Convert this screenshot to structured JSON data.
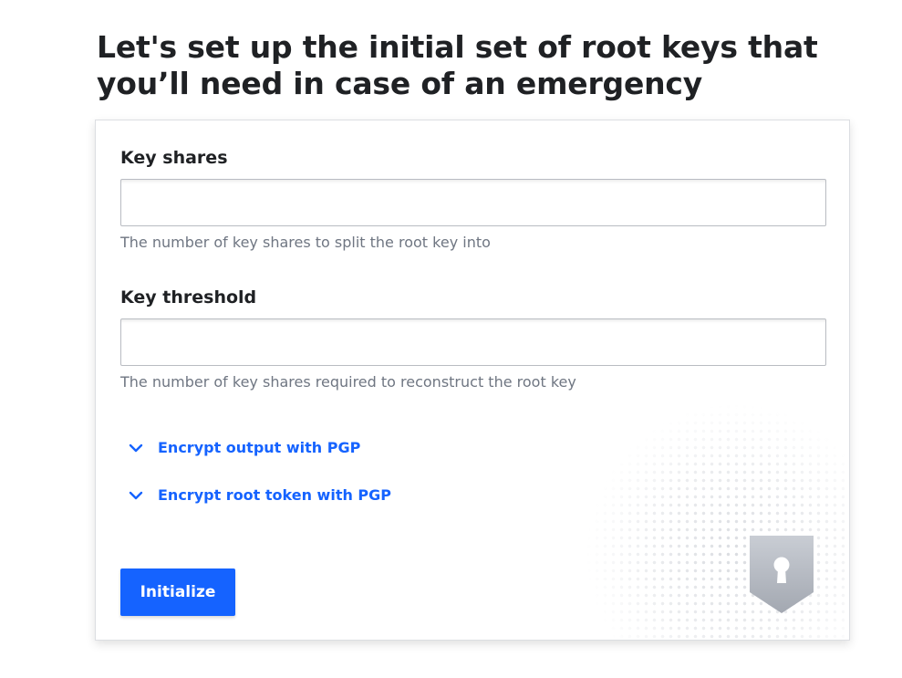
{
  "page": {
    "title": "Let's set up the initial set of root keys that you’ll need in case of an emergency"
  },
  "form": {
    "key_shares": {
      "label": "Key shares",
      "value": "",
      "placeholder": "",
      "help": "The number of key shares to split the root key into"
    },
    "key_threshold": {
      "label": "Key threshold",
      "value": "",
      "placeholder": "",
      "help": "The number of key shares required to reconstruct the root key"
    },
    "toggles": [
      {
        "label": "Encrypt output with PGP",
        "icon": "chevron-down-icon"
      },
      {
        "label": "Encrypt root token with PGP",
        "icon": "chevron-down-icon"
      }
    ],
    "submit_label": "Initialize"
  },
  "decoration": {
    "icon": "keyhole-shield-icon"
  },
  "colors": {
    "accent": "#1563ff",
    "text": "#1f2124",
    "help_text": "#6f7682",
    "border": "#dcdee2"
  }
}
